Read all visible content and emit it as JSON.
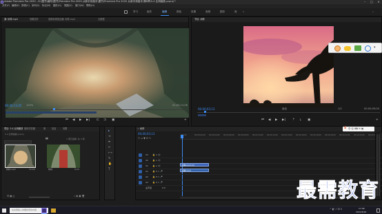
{
  "titlebar": {
    "title": "Adobe Premiere Pro 2020 - D:\\图书\\编写\\图书\\Premiere Pro 2020 从新手到高手\\图书\\Premiere Pro 2020 从新手到高手\\第6章\\5.4 比例缩放.prproj *"
  },
  "menubar": {
    "items": [
      "文件(F)",
      "编辑(E)",
      "剪辑(C)",
      "序列(S)",
      "标记(M)",
      "图形(G)",
      "视图(V)",
      "窗口(W)",
      "帮助(H)"
    ]
  },
  "workspaces": {
    "items": [
      "学习",
      "组件",
      "编辑",
      "颜色",
      "效果",
      "音频",
      "图形",
      "库"
    ],
    "active": "编辑"
  },
  "source_panel": {
    "tabs": [
      "源: 树林.mp4",
      "效果控件",
      "音频剪辑混合器: 树林.mp4",
      "元数据"
    ],
    "timecode_in": "00;00;13;05",
    "fit": "100%",
    "page": "1/2",
    "duration": "00;00;12;06"
  },
  "program_panel": {
    "tabs": [
      "节目: 树林"
    ],
    "timecode_in": "00;00;03;13",
    "fit": "适合",
    "page": "1/2",
    "duration": "00;00;09;04"
  },
  "project_panel": {
    "tabs": [
      "项目: 5.4 比例缩放",
      "媒体浏览器",
      "库",
      "信息",
      "效果"
    ],
    "project_file": "5.4 比例缩放.prproj",
    "selection": "1 项已选择, 共 3 项",
    "thumbnails": [
      {
        "name": "树林.mp4",
        "duration": "12;06"
      },
      {
        "name": "树林",
        "duration": "9;04"
      }
    ]
  },
  "timeline": {
    "tab": "树林",
    "timecode": "00;00;03;13",
    "ticks": [
      "00;00",
      "00;00;02;00",
      "00;00;04;00",
      "00;00;06;00",
      "00;00;08;00",
      "00;00;10;00",
      "00;00;12;00",
      "00;00;14;00",
      "00;00;16;00",
      "00;00;18;00",
      "00;00;20;00",
      "00;00;22;00",
      "00;00;24;00",
      "00;00;26;00"
    ],
    "tracks": [
      "V3",
      "V2",
      "V1",
      "A1",
      "A2",
      "A3",
      "主声道"
    ],
    "master_level": "0.0",
    "clip_v1": "树林.mp4 [V]",
    "clip_a1": "树林.mp4"
  },
  "taskbar": {
    "search_placeholder": "在这里输入你要搜索的内容",
    "time": "17:06",
    "date": "2021/6/22"
  },
  "watermark": {
    "text": "最需教育"
  },
  "colors": {
    "accent": "#3d8df5",
    "timecode": "#3d8df5",
    "clip_video": "#3d66b8",
    "watermark": "#1f46c8"
  }
}
